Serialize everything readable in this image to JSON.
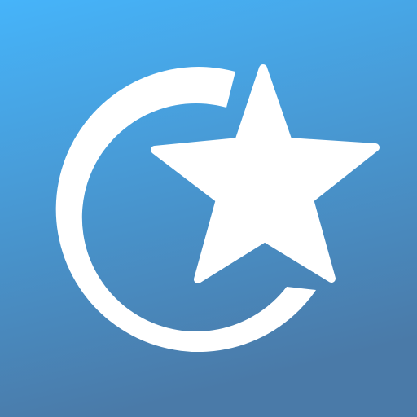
{
  "icon": {
    "name": "app-logo",
    "depicts": "crescent-and-star",
    "colors": {
      "gradient_top": "#46B4FA",
      "gradient_bottom": "#4A7AA8",
      "glyph": "#FFFFFF"
    }
  }
}
